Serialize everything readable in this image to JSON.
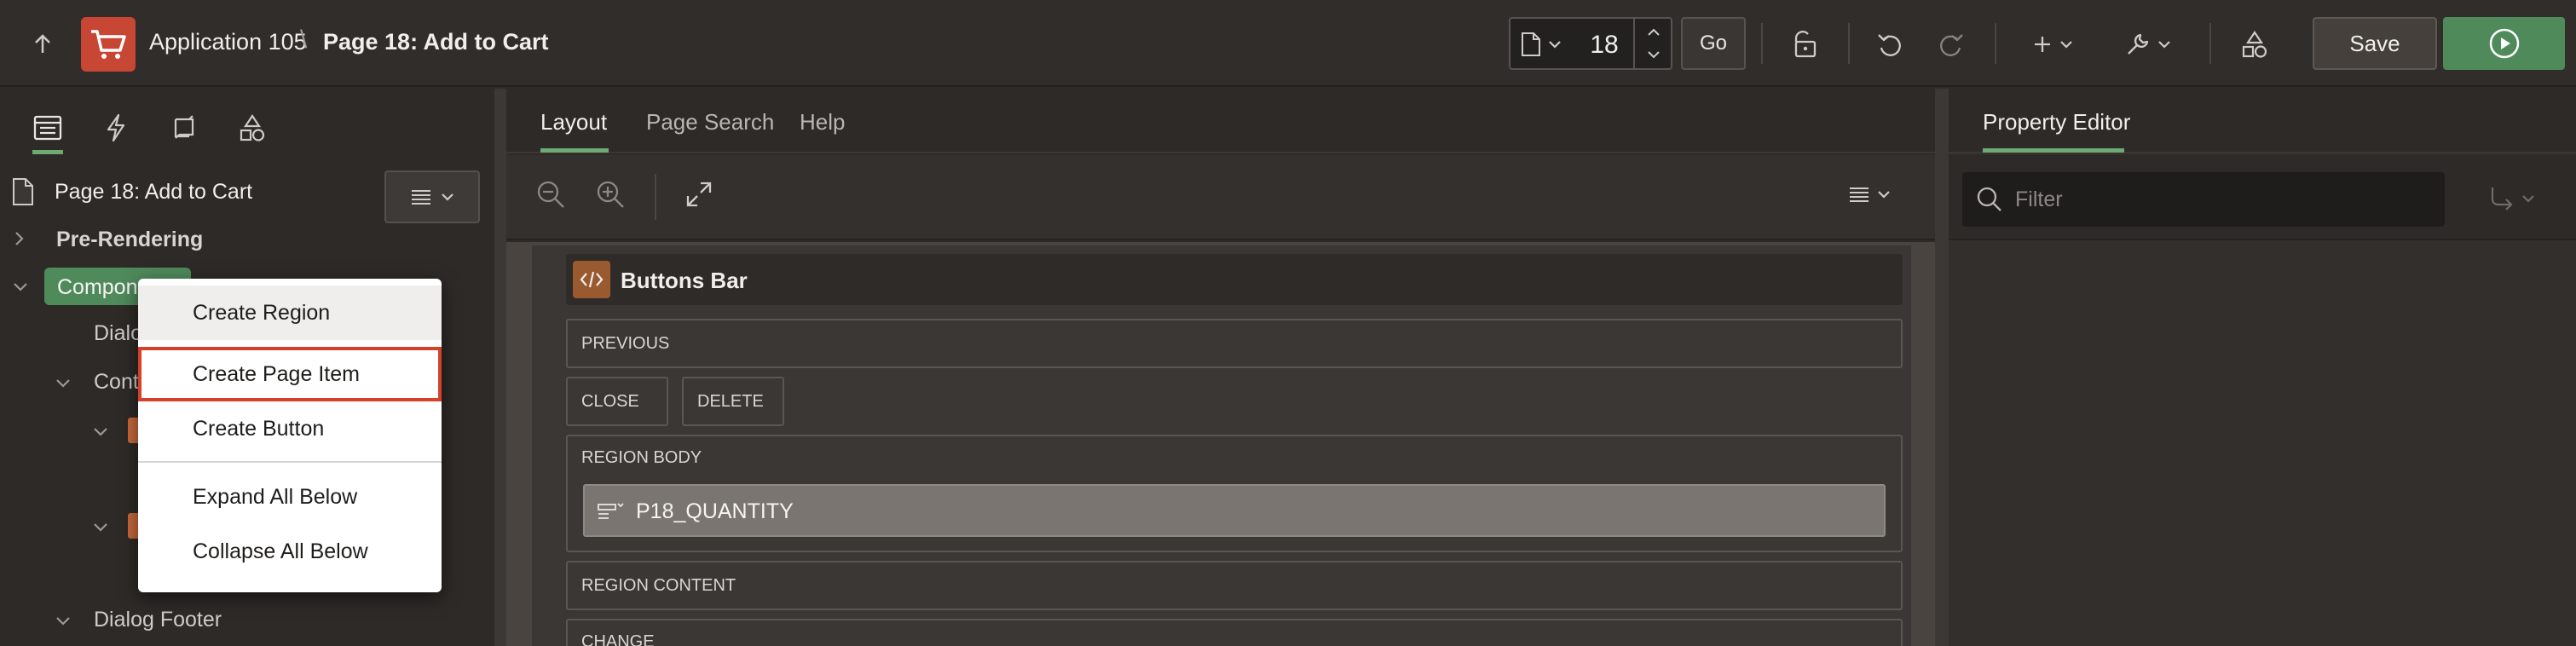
{
  "header": {
    "app_name": "Application 105",
    "breadcrumb_separator": "\\",
    "page_name": "Page 18: Add to Cart",
    "page_number": "18",
    "go_label": "Go",
    "save_label": "Save",
    "logo_color": "#c74634",
    "run_color": "#4f8a5b"
  },
  "left": {
    "tabs": [
      "rendering-icon",
      "dynamic-actions-icon",
      "processing-icon",
      "shared-components-icon"
    ],
    "tree": {
      "root": "Page 18: Add to Cart",
      "pre_rendering": "Pre-Rendering",
      "components": "Components",
      "dialog_header_partial": "Dialo",
      "content_partial": "Cont",
      "dialog_footer": "Dialog Footer"
    }
  },
  "context_menu": {
    "items": [
      "Create Region",
      "Create Page Item",
      "Create Button",
      "Expand All Below",
      "Collapse All Below"
    ],
    "highlight_color": "#d6412b"
  },
  "center": {
    "tabs": [
      "Layout",
      "Page Search",
      "Help"
    ],
    "active_tab": "Layout",
    "region_title": "Buttons Bar",
    "slots": {
      "previous": "PREVIOUS",
      "close": "CLOSE",
      "delete": "DELETE",
      "region_body": "REGION BODY",
      "region_content": "REGION CONTENT",
      "change": "CHANGE"
    },
    "page_item": "P18_QUANTITY"
  },
  "right": {
    "tab": "Property Editor",
    "filter_placeholder": "Filter"
  }
}
